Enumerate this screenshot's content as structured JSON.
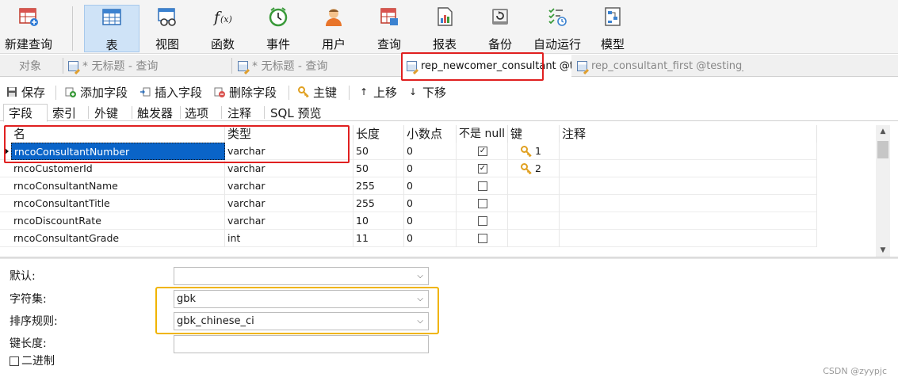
{
  "toolbar": {
    "items": [
      {
        "label": "新建查询",
        "icon": "new-query-icon"
      },
      {
        "label": "表",
        "icon": "table-icon",
        "active": true
      },
      {
        "label": "视图",
        "icon": "view-icon"
      },
      {
        "label": "函数",
        "icon": "function-icon"
      },
      {
        "label": "事件",
        "icon": "event-clock-icon"
      },
      {
        "label": "用户",
        "icon": "user-icon"
      },
      {
        "label": "查询",
        "icon": "query-icon"
      },
      {
        "label": "报表",
        "icon": "report-icon"
      },
      {
        "label": "备份",
        "icon": "backup-icon"
      },
      {
        "label": "自动运行",
        "icon": "auto-run-icon"
      },
      {
        "label": "模型",
        "icon": "model-icon"
      }
    ]
  },
  "doc_tabs": [
    {
      "label": "对象"
    },
    {
      "label": "* 无标题 - 查询"
    },
    {
      "label": "* 无标题 - 查询"
    },
    {
      "label": "rep_newcomer_consultant @te..."
    },
    {
      "label": "rep_consultant_first @testing_..."
    }
  ],
  "sub_toolbar": {
    "save": "保存",
    "add_field": "添加字段",
    "insert_field": "插入字段",
    "delete_field": "删除字段",
    "primary_key": "主键",
    "move_up": "上移",
    "move_down": "下移"
  },
  "sub_tabs": [
    "字段",
    "索引",
    "外键",
    "触发器",
    "选项",
    "注释",
    "SQL 预览"
  ],
  "grid": {
    "columns": [
      "名",
      "类型",
      "长度",
      "小数点",
      "不是 null",
      "键",
      "注释"
    ],
    "rows": [
      {
        "name": "rncoConsultantNumber",
        "type": "varchar",
        "length": "50",
        "decimals": "0",
        "not_null": true,
        "key": "1",
        "comment": ""
      },
      {
        "name": "rncoCustomerId",
        "type": "varchar",
        "length": "50",
        "decimals": "0",
        "not_null": true,
        "key": "2",
        "comment": ""
      },
      {
        "name": "rncoConsultantName",
        "type": "varchar",
        "length": "255",
        "decimals": "0",
        "not_null": false,
        "key": "",
        "comment": ""
      },
      {
        "name": "rncoConsultantTitle",
        "type": "varchar",
        "length": "255",
        "decimals": "0",
        "not_null": false,
        "key": "",
        "comment": ""
      },
      {
        "name": "rncoDiscountRate",
        "type": "varchar",
        "length": "10",
        "decimals": "0",
        "not_null": false,
        "key": "",
        "comment": ""
      },
      {
        "name": "rncoConsultantGrade",
        "type": "int",
        "length": "11",
        "decimals": "0",
        "not_null": false,
        "key": "",
        "comment": ""
      }
    ]
  },
  "properties": {
    "default_label": "默认:",
    "default_value": "",
    "charset_label": "字符集:",
    "charset_value": "gbk",
    "collation_label": "排序规则:",
    "collation_value": "gbk_chinese_ci",
    "key_length_label": "键长度:",
    "key_length_value": "",
    "binary_label": "二进制"
  },
  "watermark": "CSDN @zyypjc",
  "colors": {
    "selection": "#0a64c8",
    "annotation_red": "#e02020",
    "annotation_yellow": "#f0b400",
    "key_gold": "#e0a020"
  }
}
